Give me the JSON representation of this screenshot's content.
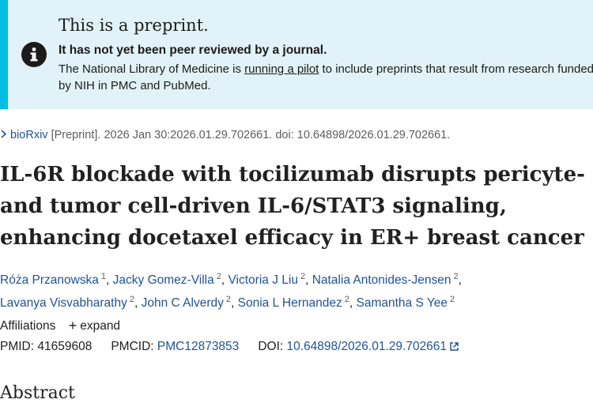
{
  "banner": {
    "title": "This is a preprint.",
    "subtitle": "It has not yet been peer reviewed by a journal.",
    "text_before_link": "The National Library of Medicine is ",
    "link_text": "running a pilot",
    "text_after_link": " to include preprints that result from research funded by NIH in PMC and PubMed.",
    "icon": "info-icon"
  },
  "citation": {
    "journal": "bioRxiv",
    "rest": " [Preprint]. 2026 Jan 30:2026.01.29.702661. doi: 10.64898/2026.01.29.702661."
  },
  "article": {
    "title_lines": [
      "IL-6R blockade with tocilizumab disrupts pericyte-",
      "and tumor cell-driven IL-6/STAT3 signaling,",
      "enhancing docetaxel efficacy in ER+ breast cancer"
    ]
  },
  "authors": [
    {
      "name": "Róża Przanowska",
      "sup": "1"
    },
    {
      "name": "Jacky Gomez-Villa",
      "sup": "2"
    },
    {
      "name": "Victoria J Liu",
      "sup": "2"
    },
    {
      "name": "Natalia Antonides-Jensen",
      "sup": "2"
    },
    {
      "name": "Lavanya Visvabharathy",
      "sup": "2"
    },
    {
      "name": "John C Alverdy",
      "sup": "2"
    },
    {
      "name": "Sonia L Hernandez",
      "sup": "2"
    },
    {
      "name": "Samantha S Yee",
      "sup": "2"
    }
  ],
  "affiliations": {
    "label": "Affiliations",
    "expand": "expand"
  },
  "ids": {
    "pmid_label": "PMID: 41659608",
    "pmcid_label": "PMCID: ",
    "pmcid_value": "PMC12873853",
    "doi_label": "DOI: ",
    "doi_value": "10.64898/2026.01.29.702661"
  },
  "abstract_heading": "Abstract"
}
